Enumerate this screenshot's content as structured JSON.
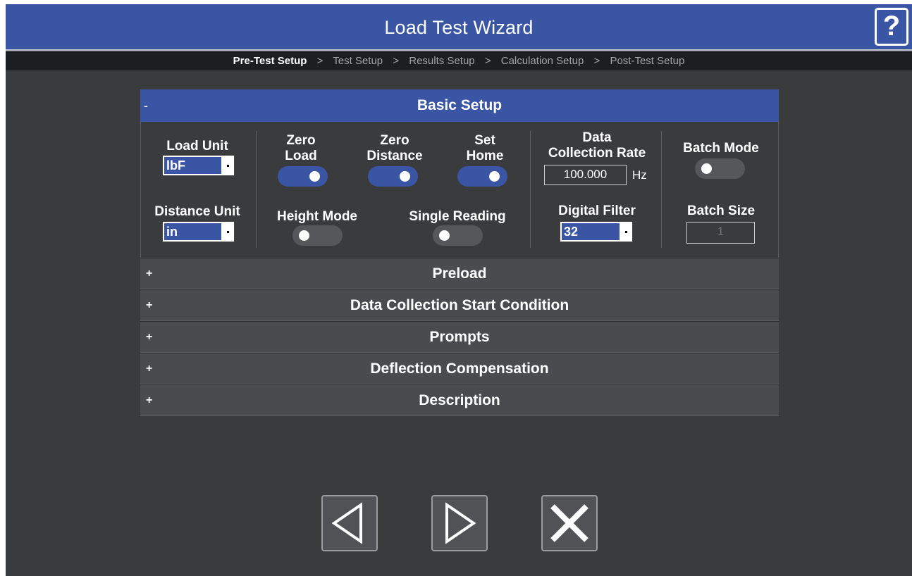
{
  "window": {
    "title": "Load Test Wizard",
    "help_label": "?"
  },
  "breadcrumb": {
    "items": [
      {
        "label": "Pre-Test Setup",
        "active": true
      },
      {
        "label": "Test Setup",
        "active": false
      },
      {
        "label": "Results Setup",
        "active": false
      },
      {
        "label": "Calculation Setup",
        "active": false
      },
      {
        "label": "Post-Test Setup",
        "active": false
      }
    ],
    "separator": ">"
  },
  "basic_setup": {
    "title": "Basic Setup",
    "toggle": "-",
    "load_unit": {
      "label": "Load Unit",
      "value": "lbF"
    },
    "distance_unit": {
      "label": "Distance Unit",
      "value": "in"
    },
    "zero_load": {
      "label_line1": "Zero",
      "label_line2": "Load",
      "state": "on"
    },
    "zero_distance": {
      "label_line1": "Zero",
      "label_line2": "Distance",
      "state": "on"
    },
    "set_home": {
      "label_line1": "Set",
      "label_line2": "Home",
      "state": "on"
    },
    "height_mode": {
      "label": "Height Mode",
      "state": "off"
    },
    "single_reading": {
      "label": "Single Reading",
      "state": "off"
    },
    "data_collection_rate": {
      "label_line1": "Data",
      "label_line2": "Collection Rate",
      "value": "100.000",
      "unit": "Hz"
    },
    "digital_filter": {
      "label": "Digital Filter",
      "value": "32"
    },
    "batch_mode": {
      "label": "Batch Mode",
      "state": "off"
    },
    "batch_size": {
      "label": "Batch Size",
      "value": "1"
    }
  },
  "sections": [
    {
      "toggle": "+",
      "title": "Preload"
    },
    {
      "toggle": "+",
      "title": "Data Collection Start Condition"
    },
    {
      "toggle": "+",
      "title": "Prompts"
    },
    {
      "toggle": "+",
      "title": "Deflection Compensation"
    },
    {
      "toggle": "+",
      "title": "Description"
    }
  ],
  "nav": {
    "back": "left-triangle-icon",
    "next": "right-triangle-icon",
    "cancel": "close-x-icon"
  },
  "colors": {
    "accent": "#3a55a4",
    "background": "#3a3b3d",
    "breadcrumb_bg": "#1d1e20",
    "section_bg": "#494b4f",
    "toggle_off": "#55575b"
  }
}
